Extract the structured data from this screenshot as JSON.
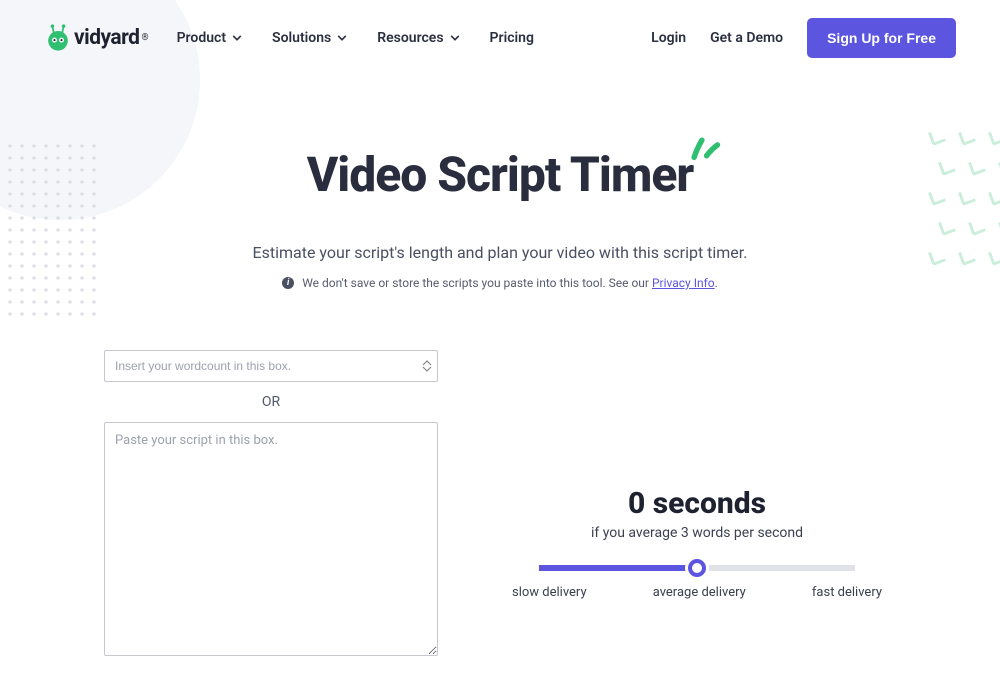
{
  "brand": {
    "name": "vidyard"
  },
  "nav": {
    "items": [
      {
        "label": "Product"
      },
      {
        "label": "Solutions"
      },
      {
        "label": "Resources"
      },
      {
        "label": "Pricing"
      }
    ],
    "login": "Login",
    "demo": "Get a Demo",
    "signup": "Sign Up for Free"
  },
  "hero": {
    "title": "Video Script Timer",
    "subtitle": "Estimate your script's length and plan your video with this script timer.",
    "privacy_prefix": "We don't save or store the scripts you paste into this tool. See our ",
    "privacy_link": "Privacy Info",
    "privacy_suffix": "."
  },
  "inputs": {
    "wordcount_placeholder": "Insert your wordcount in this box.",
    "or": "OR",
    "script_placeholder": "Paste your script in this box."
  },
  "result": {
    "value": "0 seconds",
    "subtext": "if you average 3 words per second"
  },
  "slider": {
    "slow": "slow delivery",
    "average": "average delivery",
    "fast": "fast delivery"
  }
}
